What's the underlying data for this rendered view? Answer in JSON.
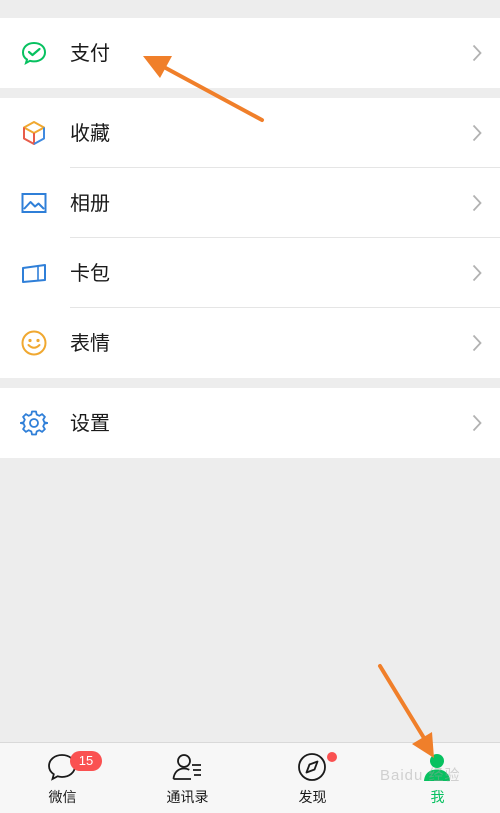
{
  "menu": {
    "payment": "支付",
    "favorites": "收藏",
    "album": "相册",
    "cards": "卡包",
    "stickers": "表情",
    "settings": "设置"
  },
  "tabbar": {
    "chats": "微信",
    "chats_badge": "15",
    "contacts": "通讯录",
    "discover": "发现",
    "me": "我"
  },
  "watermark": "Baidu 经验",
  "colors": {
    "accent_green": "#07c160",
    "badge_red": "#fa5151",
    "annotation_orange": "#f07f2a",
    "background": "#ededed"
  },
  "icons": {
    "payment": "wechat-pay-icon",
    "favorites": "cube-icon",
    "album": "picture-icon",
    "cards": "card-wallet-icon",
    "stickers": "smiley-icon",
    "settings": "gear-icon",
    "chats": "chat-bubble-icon",
    "contacts": "contacts-icon",
    "discover": "compass-icon",
    "me": "person-icon"
  }
}
